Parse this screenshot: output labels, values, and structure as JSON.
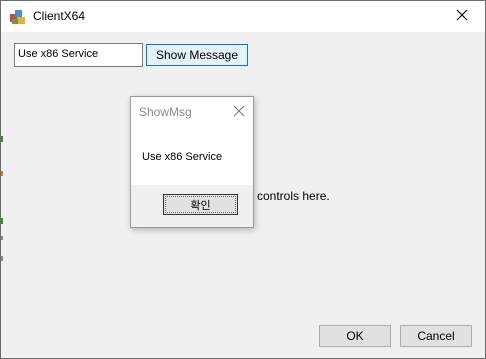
{
  "window": {
    "title": "ClientX64"
  },
  "controls": {
    "input_value": "Use x86 Service",
    "show_message_label": "Show Message",
    "hint_text": "controls here.",
    "ok_label": "OK",
    "cancel_label": "Cancel"
  },
  "message_box": {
    "title": "ShowMsg",
    "message": "Use x86 Service",
    "confirm_label": "확인"
  },
  "colors": {
    "accent_border": "#0078d7",
    "button_bg": "#e1e1e1",
    "window_bg": "#f0f0f0"
  },
  "icons": [
    "app-icon",
    "close-icon",
    "dialog-close-icon"
  ]
}
